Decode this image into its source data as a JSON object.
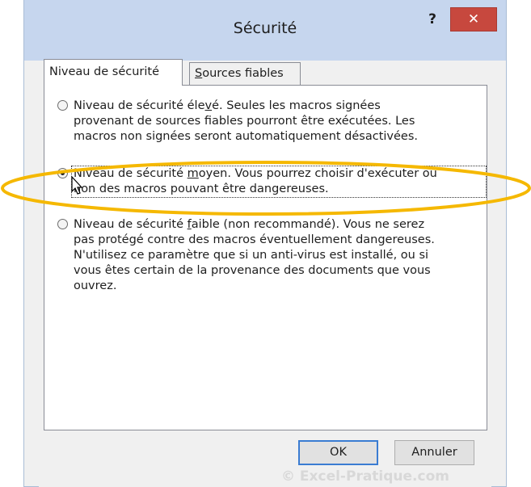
{
  "window": {
    "title": "Sécurité",
    "help_label": "?",
    "close_label": "✕"
  },
  "tabs": [
    {
      "label_pre": "Niveau de sécurité",
      "label_u": "",
      "label_post": "",
      "active": true
    },
    {
      "label_pre": "",
      "label_u": "S",
      "label_post": "ources fiables",
      "active": false
    }
  ],
  "options": [
    {
      "checked": false,
      "lines": [
        "Niveau de sécurité éle",
        "v",
        "é. Seules les macros signées",
        "provenant de sources fiables pourront être exécutées. Les",
        "macros non signées seront automatiquement désactivées."
      ]
    },
    {
      "checked": true,
      "lines": [
        "Niveau de sécurité ",
        "m",
        "oyen. Vous pourrez choisir d'exécuter ou",
        "non des macros pouvant être dangereuses."
      ]
    },
    {
      "checked": false,
      "lines": [
        "Niveau de sécurité ",
        "f",
        "aible (non recommandé). Vous ne serez",
        "pas protégé contre des macros éventuellement dangereuses.",
        "N'utilisez ce paramètre que si un anti-virus est installé, ou si",
        "vous êtes certain de la provenance des documents que vous",
        "ouvrez."
      ]
    }
  ],
  "buttons": {
    "ok_label": "OK",
    "cancel_label": "Annuler"
  },
  "watermark": "© Excel-Pratique.com",
  "colors": {
    "titlebar": "#c6d6ee",
    "close": "#c7483e",
    "highlight_ellipse": "#f5b800"
  }
}
